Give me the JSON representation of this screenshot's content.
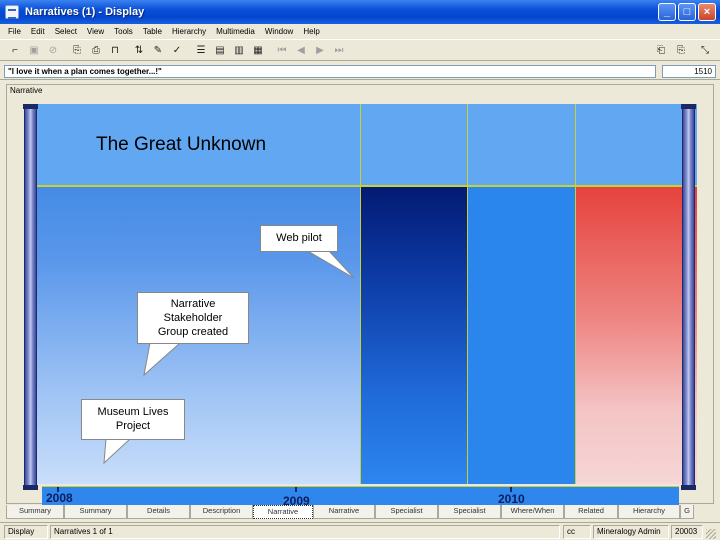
{
  "window": {
    "title": "Narratives (1) - Display",
    "minimize_glyph": "_",
    "maximize_glyph": "□",
    "close_glyph": "×"
  },
  "menu": [
    "File",
    "Edit",
    "Select",
    "View",
    "Tools",
    "Table",
    "Hierarchy",
    "Multimedia",
    "Window",
    "Help"
  ],
  "prompt": {
    "text": "\"I love it when a plan comes together...!\"",
    "count": "1510"
  },
  "narrative": {
    "label": "Narrative",
    "title": "The Great Unknown",
    "callouts": {
      "web_pilot": "Web pilot",
      "stakeholder": [
        "Narrative",
        "Stakeholder",
        "Group created"
      ],
      "museum_lives": [
        "Museum Lives",
        "Project"
      ]
    },
    "timeline_years": [
      "2008",
      "2009",
      "2010"
    ]
  },
  "tabs": [
    "Summary",
    "Summary",
    "Details",
    "Description",
    "Narrative",
    "Narrative",
    "Specialist",
    "Specialist",
    "Where/When",
    "Related",
    "Hierarchy",
    "G"
  ],
  "active_tab_index": 4,
  "status": {
    "mode": "Display",
    "record": "Narratives 1 of 1",
    "flag": "cc",
    "user": "Mineralogy Admin",
    "code": "20003"
  },
  "colors": {
    "title_bar": "#0a4fd8",
    "stage_top": "#2e7fe2",
    "header_band": "#62a7f2",
    "dark_column": "#031a73",
    "red_column": "#e6423d",
    "grid_line": "#c8d22f"
  }
}
